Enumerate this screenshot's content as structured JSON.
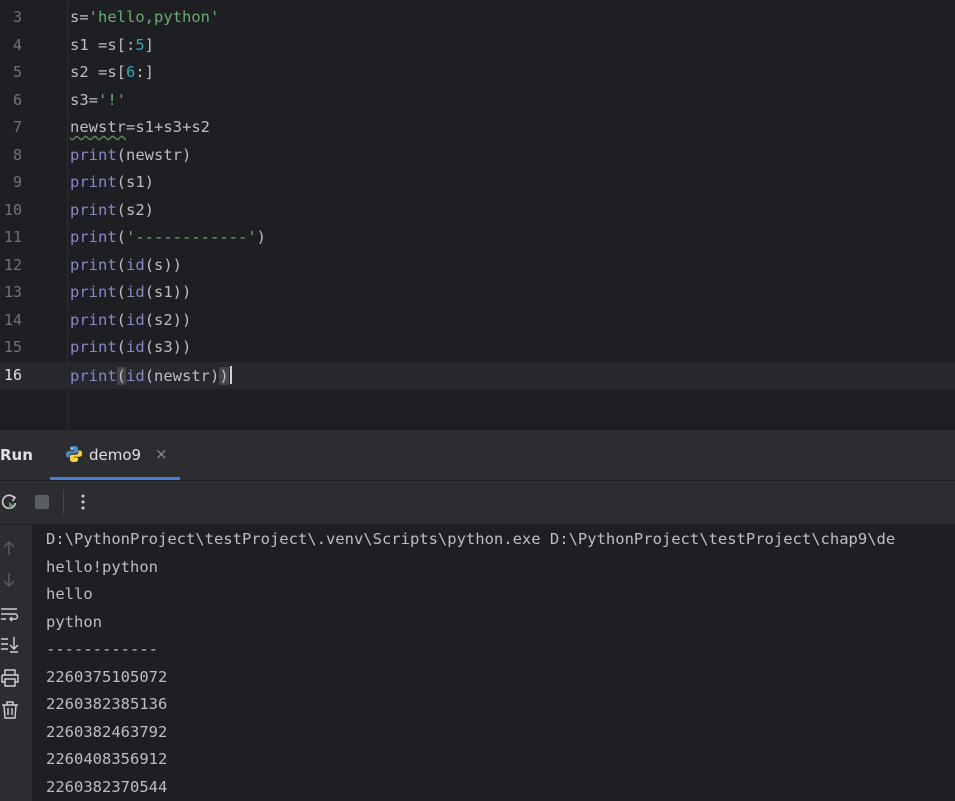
{
  "editor": {
    "line_numbers": [
      "3",
      "4",
      "5",
      "6",
      "7",
      "8",
      "9",
      "10",
      "11",
      "12",
      "13",
      "14",
      "15",
      "16"
    ],
    "lines": {
      "l3": {
        "a": "s=",
        "str": "'hello,python'"
      },
      "l4": {
        "a": "s1 =s[:",
        "num": "5",
        "b": "]"
      },
      "l5": {
        "a": "s2 =s[",
        "num": "6",
        "b": ":]"
      },
      "l6": {
        "a": "s3=",
        "str": "'!'"
      },
      "l7": {
        "warn": "newstr",
        "b": "=s1+s3+s2"
      },
      "l8": {
        "fn": "print",
        "b": "(newstr)"
      },
      "l9": {
        "fn": "print",
        "b": "(s1)"
      },
      "l10": {
        "fn": "print",
        "b": "(s2)"
      },
      "l11": {
        "fn": "print",
        "a": "(",
        "str": "'------------'",
        "b": ")"
      },
      "l12": {
        "fn": "print",
        "a": "(",
        "fn2": "id",
        "b": "(s))"
      },
      "l13": {
        "fn": "print",
        "a": "(",
        "fn2": "id",
        "b": "(s1))"
      },
      "l14": {
        "fn": "print",
        "a": "(",
        "fn2": "id",
        "b": "(s2))"
      },
      "l15": {
        "fn": "print",
        "a": "(",
        "fn2": "id",
        "b": "(s3))"
      },
      "l16": {
        "fn": "print",
        "open": "(",
        "fn2": "id",
        "b": "(newstr)",
        "close": ")"
      }
    }
  },
  "run_panel": {
    "title": "Run",
    "tab_label": "demo9",
    "tab_close": "×",
    "output": [
      "D:\\PythonProject\\testProject\\.venv\\Scripts\\python.exe D:\\PythonProject\\testProject\\chap9\\de",
      "hello!python",
      "hello",
      "python",
      "------------",
      "2260375105072",
      "2260382385136",
      "2260382463792",
      "2260408356912",
      "2260382370544"
    ]
  },
  "icons": [
    "rerun-icon",
    "stop-icon",
    "more-options-icon",
    "python-icon",
    "up-arrow-icon",
    "down-arrow-icon",
    "soft-wrap-icon",
    "scroll-to-end-icon",
    "print-icon",
    "trash-icon"
  ],
  "colors": {
    "string": "#6aab73",
    "number": "#2aacb8",
    "builtin": "#8888c6",
    "accent": "#4a7dd6"
  }
}
